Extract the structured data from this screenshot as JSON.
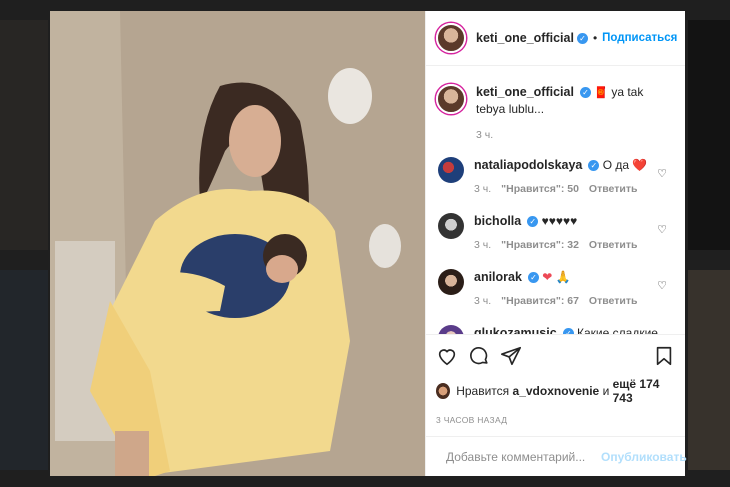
{
  "post": {
    "author": "keti_one_official",
    "follow_label": "Подписаться",
    "dot": "•",
    "caption": "ya tak tebya lublu...",
    "caption_time": "3 ч."
  },
  "comments": [
    {
      "user": "nataliapodolskaya",
      "text": "О да",
      "emoji": "❤️",
      "time": "3 ч.",
      "likes": "\"Нравится\": 50",
      "reply": "Ответить"
    },
    {
      "user": "bicholla",
      "text": "",
      "emoji": "♥♥♥♥♥",
      "time": "3 ч.",
      "likes": "\"Нравится\": 32",
      "reply": "Ответить"
    },
    {
      "user": "anilorak",
      "text": "",
      "emoji": "❤ 🙏",
      "time": "3 ч.",
      "likes": "\"Нравится\": 67",
      "reply": "Ответить"
    },
    {
      "user": "glukozamusic",
      "text": "Какие сладкие",
      "emoji": "❤❤❤❤",
      "time": "",
      "likes": "",
      "reply": ""
    }
  ],
  "likes": {
    "prefix": "Нравится",
    "user": "a_vdoxnovenie",
    "middle": "и",
    "count": "ещё 174 743"
  },
  "timestamp": "3 ЧАСОВ НАЗАД",
  "add_comment": {
    "placeholder": "Добавьте комментарий...",
    "publish_label": "Опубликовать"
  },
  "icons": {
    "like": "heart-icon",
    "comment": "comment-icon",
    "share": "share-icon",
    "save": "bookmark-icon",
    "emoji": "smiley-icon"
  },
  "colors": {
    "verified": "#3897f0",
    "link": "#0095f6",
    "heart": "#ed4956",
    "muted": "#8e8e8e"
  }
}
